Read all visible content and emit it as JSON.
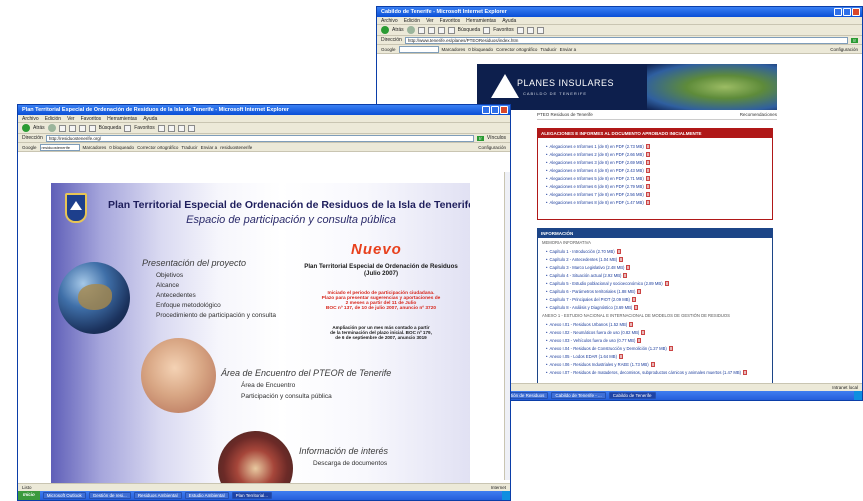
{
  "back_window": {
    "title": "Cabildo de Tenerife - Microsoft Internet Explorer",
    "menu": [
      "Archivo",
      "Edición",
      "Ver",
      "Favoritos",
      "Herramientas",
      "Ayuda"
    ],
    "toolbar": [
      "Atrás",
      "Búsqueda",
      "Favoritos"
    ],
    "address_label": "Dirección",
    "address": "http://www.tenerife.es/planes/PTEOResiduos/index.htm",
    "go": "Ir",
    "google_label": "Google",
    "google_tools": [
      "Marcadores",
      "0 bloqueado",
      "Corrector ortográfico",
      "Traducir",
      "Enviar a"
    ],
    "config": "Configuración",
    "banner_title": "PLANES INSULARES",
    "banner_sub": "CABILDO DE TENERIFE",
    "breadcrumb_left": "PTEO Residuos de Tenerife",
    "breadcrumb_right": "Recomendaciones",
    "panel1_title": "ALEGACIONES E INFORMES AL DOCUMENTO APROBADO INICIALMENTE",
    "panel1_items": [
      "Alegaciones e Informes 1 (de 8) en PDF (2.73 MB)",
      "Alegaciones e Informes 2 (de 8) en PDF (2.66 MB)",
      "Alegaciones e Informes 3 (de 8) en PDF (2.69 MB)",
      "Alegaciones e Informes 4 (de 8) en PDF (2.43 MB)",
      "Alegaciones e Informes 5 (de 8) en PDF (2.71 MB)",
      "Alegaciones e Informes 6 (de 8) en PDF (2.79 MB)",
      "Alegaciones e Informes 7 (de 8) en PDF (2.56 MB)",
      "Alegaciones e Informes 8 (de 8) en PDF (1.47 MB)"
    ],
    "panel2_title": "INFORMACIÓN",
    "panel2_sub1": "MEMORIA INFORMATIVA",
    "panel2_items1": [
      "Capítulo 1 - Introducción (2.70 MB)",
      "Capítulo 2 - Antecedentes (1.04 MB)",
      "Capítulo 3 - Marco Legislativo (2.48 MB)",
      "Capítulo 4 - Situación actual (2.92 MB)",
      "Capítulo 5 - Estudio poblacional y socioeconómico (2.89 MB)",
      "Capítulo 6 - Parámetros territoriales (1.88 MB)",
      "Capítulo 7 - Principales del PIOT (2.09 MB)",
      "Capítulo 8 - Análisis y Diagnóstico (3.69 MB)"
    ],
    "panel2_sub2": "ANEXO 1 - ESTUDIO NACIONAL E INTERNACIONAL DE MODELOS DE GESTIÓN DE RESIDUOS",
    "panel2_items2": [
      "Anexo I.01 - Residuos Urbanos (1.52 MB)",
      "Anexo I.02 - Neumáticos fuera de uso (0.82 MB)",
      "Anexo I.03 - Vehículos fuera de uso (0.77 MB)",
      "Anexo I.04 - Residuos de Construcción y Demolición (1.27 MB)",
      "Anexo I.05 - Lodos EDAR (1.64 MB)",
      "Anexo I.06 - Residuos Industriales y RAEE (1.73 MB)",
      "Anexo I.07 - Residuos de mataderos, decomisos, subproductos cárnicos y animales muertos (1.47 MB)"
    ],
    "status_right": "Intranet local",
    "taskbar_items": [
      "Inicio",
      "Microsoft Outlook",
      "Residuos Ambiental",
      "Gestión de Residuos",
      "Cabildo de Tenerife - ...",
      "Cabildo de Tenerife"
    ]
  },
  "front_window": {
    "title": "Plan Territorial Especial de Ordenación de Residuos de la Isla de Tenerife - Microsoft Internet Explorer",
    "menu": [
      "Archivo",
      "Edición",
      "Ver",
      "Favoritos",
      "Herramientas",
      "Ayuda"
    ],
    "toolbar": [
      "Atrás",
      "Búsqueda",
      "Favoritos"
    ],
    "address_label": "Dirección",
    "address": "http://residuostenerife.org/",
    "go": "Ir",
    "links": "Vínculos",
    "google_label": "Google",
    "google_search": "residuostenerife",
    "google_tools": [
      "Marcadores",
      "0 bloqueado",
      "Corrector ortográfico",
      "Traducir",
      "Enviar a",
      "residuostenerife"
    ],
    "config": "Configuración",
    "page_title": "Plan Territorial Especial de Ordenación de Residuos de la Isla de Tenerife",
    "page_subtitle": "Espacio de participación y consulta pública",
    "section1_title": "Presentación del proyecto",
    "section1_links": [
      "Objetivos",
      "Alcance",
      "Antecedentes",
      "Enfoque metodológico",
      "Procedimiento de participación y consulta"
    ],
    "section2_title": "Área de Encuentro del PTEOR de Tenerife",
    "section2_links": [
      "Área de Encuentro",
      "Participación y consulta pública"
    ],
    "section3_title": "Información de interés",
    "section3_links": [
      "Descarga de documentos"
    ],
    "nuevo": "Nuevo",
    "news_title_lines": [
      "Plan Territorial Especial de Ordenación de Residuos",
      "(Julio 2007)"
    ],
    "news_red_lines": [
      "Iniciado el periodo de participación ciudadana.",
      "Plazo para presentar sugerencias y aportaciones de",
      "2 meses a partir del 11 de Julio",
      "BOC nº 137, de 10 de julio 2007, anuncio nº 3720"
    ],
    "news_black_lines": [
      "Ampliación por un mes más contado a partir",
      "de la terminación del plazo inicial. BOC nº 179,",
      "de 6 de septiembre de 2007, anuncio 3019"
    ],
    "status_left": "Listo",
    "status_right": "Internet",
    "taskbar_items": [
      "Inicio",
      "Microsoft Outlook",
      "Gestión de resi...",
      "Residuos Ambiental",
      "Estudio Ambiental",
      "Plan Territorial..."
    ]
  }
}
